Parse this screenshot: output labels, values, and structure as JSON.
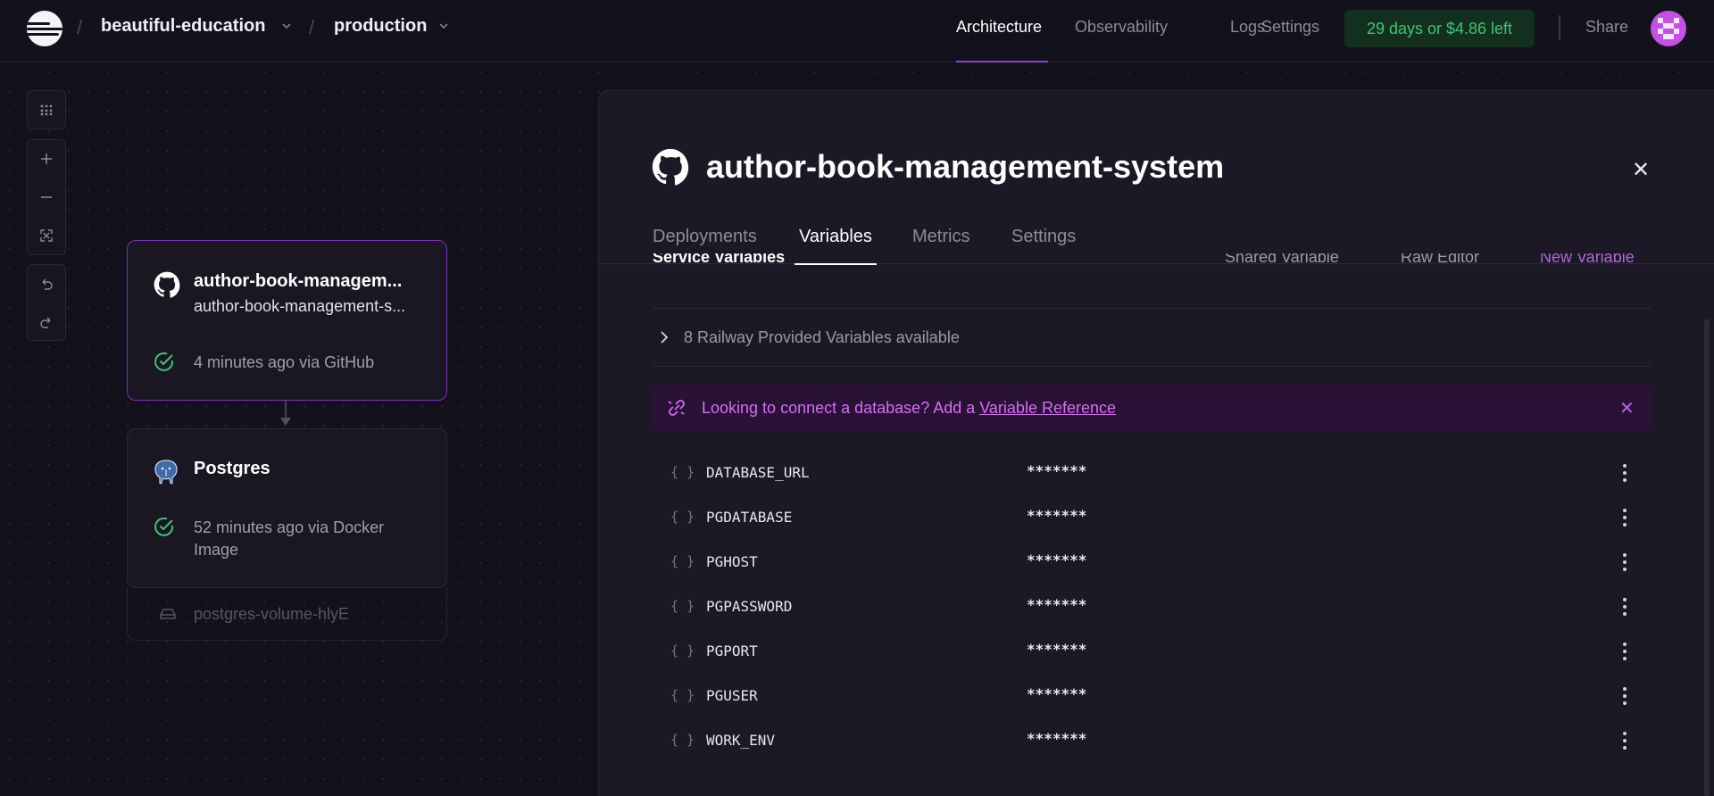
{
  "header": {
    "project": "beautiful-education",
    "environment": "production",
    "nav": [
      "Architecture",
      "Observability",
      "Logs",
      "Settings"
    ],
    "active_nav": "Architecture",
    "trial": "29 days or $4.86 left",
    "share": "Share"
  },
  "canvas": {
    "service_node": {
      "title": "author-book-managem...",
      "subtitle": "author-book-management-s...",
      "status": "4 minutes ago via GitHub"
    },
    "postgres_node": {
      "title": "Postgres",
      "status": "52 minutes ago via Docker Image"
    },
    "volume": "postgres-volume-hlyE"
  },
  "panel": {
    "title": "author-book-management-system",
    "tabs": [
      "Deployments",
      "Variables",
      "Metrics",
      "Settings"
    ],
    "active_tab": "Variables",
    "partial_header": {
      "section": "Service Variables",
      "shared": "Shared Variable",
      "raw": "Raw Editor",
      "new": "New Variable"
    },
    "provided": "8 Railway Provided Variables available",
    "banner": {
      "text": "Looking to connect a database? Add a ",
      "link": "Variable Reference"
    },
    "variables": [
      {
        "name": "DATABASE_URL",
        "value": "*******"
      },
      {
        "name": "PGDATABASE",
        "value": "*******"
      },
      {
        "name": "PGHOST",
        "value": "*******"
      },
      {
        "name": "PGPASSWORD",
        "value": "*******"
      },
      {
        "name": "PGPORT",
        "value": "*******"
      },
      {
        "name": "PGUSER",
        "value": "*******"
      },
      {
        "name": "WORK_ENV",
        "value": "*******"
      }
    ],
    "brace": "{}"
  },
  "colors": {
    "accent": "#8b3fd9",
    "success": "#3ec476",
    "banner_text": "#d46ef2"
  }
}
